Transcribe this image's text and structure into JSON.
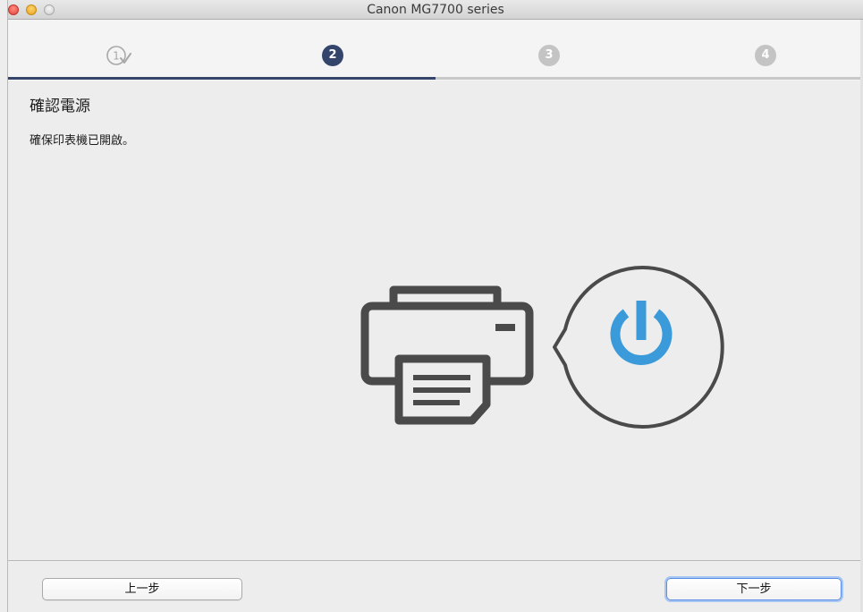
{
  "window": {
    "title": "Canon MG7700 series",
    "controls": [
      "close-button",
      "minimize-button",
      "zoom-button"
    ]
  },
  "steps": {
    "items": [
      {
        "label": "1",
        "state": "completed"
      },
      {
        "label": "2",
        "state": "current"
      },
      {
        "label": "3",
        "state": "upcoming"
      },
      {
        "label": "4",
        "state": "upcoming"
      }
    ],
    "progress_fraction": 0.5,
    "colors": {
      "current": "#34456c",
      "upcoming": "#c4c4c4",
      "completed": "#b0b0b0"
    }
  },
  "content": {
    "title": "確認電源",
    "description": "確保印表機已開啟。"
  },
  "illustration": {
    "icons": [
      "printer-icon",
      "power-icon"
    ],
    "colors": {
      "outline": "#4a4a4a",
      "power": "#3b9ad9"
    }
  },
  "footer": {
    "back_label": "上一步",
    "next_label": "下一步"
  }
}
